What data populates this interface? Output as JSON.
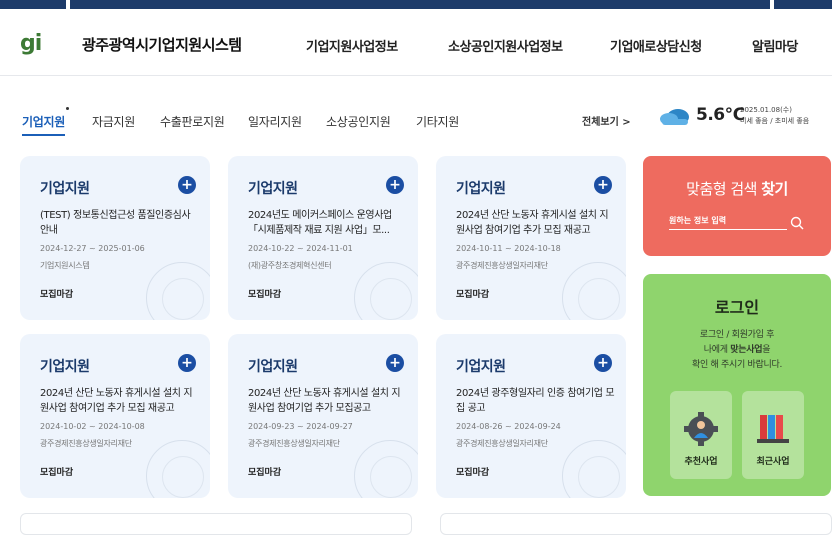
{
  "header": {
    "logo": "gi",
    "site_title": "광주광역시기업지원시스템",
    "nav": [
      "기업지원사업정보",
      "소상공인지원사업정보",
      "기업애로상담신청",
      "알림마당"
    ]
  },
  "tabs": [
    "기업지원",
    "자금지원",
    "수출판로지원",
    "일자리지원",
    "소상공인지원",
    "기타지원"
  ],
  "view_all": "전체보기 >",
  "weather": {
    "icon": "cloud-icon",
    "temperature": "5.6℃",
    "date": "2025.01.08(수)",
    "air": "미세 좋음 / 초미세 좋음"
  },
  "cards": [
    {
      "category": "기업지원",
      "title": "(TEST) 정보통신접근성 품질인증심사 안내",
      "date": "2024-12-27 ~ 2025-01-06",
      "org": "기업지원시스템",
      "status": "모집마감"
    },
    {
      "category": "기업지원",
      "title": "2024년도 메이커스페이스 운영사업 「시제품제작 재료 지원 사업」모...",
      "date": "2024-10-22 ~ 2024-11-01",
      "org": "(재)광주창조경제혁신센터",
      "status": "모집마감"
    },
    {
      "category": "기업지원",
      "title": "2024년 산단 노동자 휴게시설 설치 지원사업 참여기업 추가 모집 재공고",
      "date": "2024-10-11 ~ 2024-10-18",
      "org": "광주경제진흥상생일자리재단",
      "status": "모집마감"
    },
    {
      "category": "기업지원",
      "title": "2024년 산단 노동자 휴게시설 설치 지원사업 참여기업 추가 모집 재공고",
      "date": "2024-10-02 ~ 2024-10-08",
      "org": "광주경제진흥상생일자리재단",
      "status": "모집마감"
    },
    {
      "category": "기업지원",
      "title": "2024년 산단 노동자 휴게시설 설치 지원사업 참여기업 추가 모집공고",
      "date": "2024-09-23 ~ 2024-09-27",
      "org": "광주경제진흥상생일자리재단",
      "status": "모집마감"
    },
    {
      "category": "기업지원",
      "title": "2024년 광주형일자리 인증 참여기업 모집 공고",
      "date": "2024-08-26 ~ 2024-09-24",
      "org": "광주경제진흥상생일자리재단",
      "status": "모집마감"
    }
  ],
  "search": {
    "title_prefix": "맞춤형 검색",
    "title_strong": "찾기",
    "placeholder": "원하는 정보 입력"
  },
  "login": {
    "title": "로그인",
    "desc_line1": "로그인 / 회원가입 후",
    "desc_line2_prefix": "나에게 ",
    "desc_line2_strong": "맞는사업",
    "desc_line2_suffix": "을",
    "desc_line3": "확인 해 주시기 바랍니다.",
    "buttons": [
      {
        "label": "추천사업",
        "icon": "gear-person-icon"
      },
      {
        "label": "최근사업",
        "icon": "books-icon"
      }
    ]
  },
  "colors": {
    "accent": "#1b5fb8",
    "card_bg": "#eef4fc",
    "search_bg": "#ee6b5f",
    "login_bg": "#8fd46d"
  }
}
